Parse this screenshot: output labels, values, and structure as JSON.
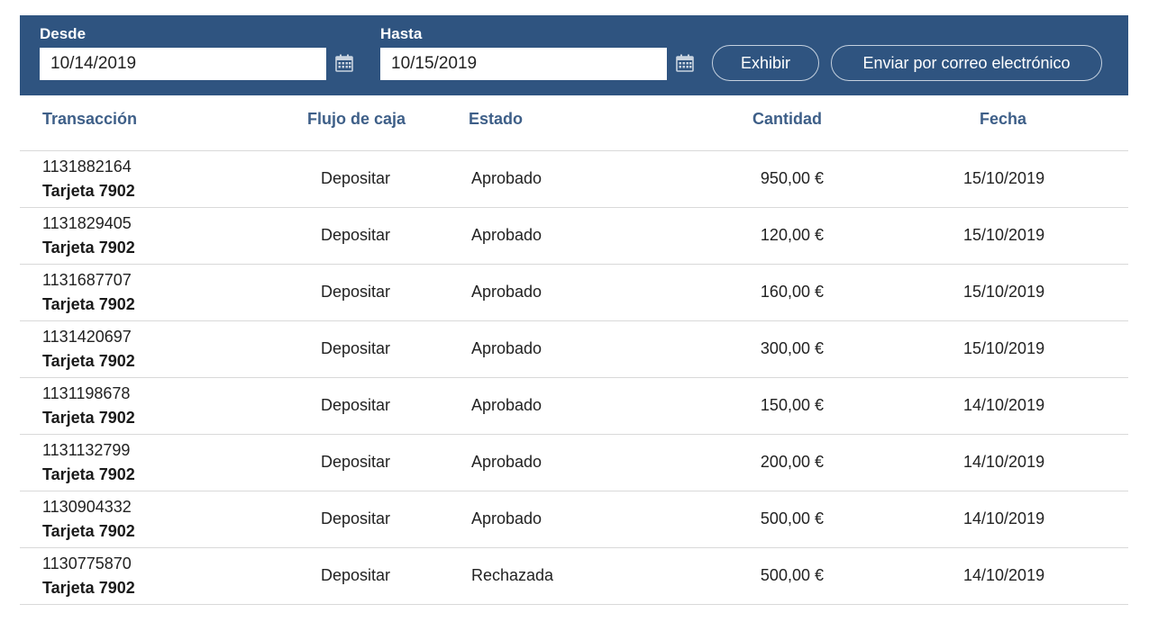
{
  "filters": {
    "from_label": "Desde",
    "from_value": "10/14/2019",
    "to_label": "Hasta",
    "to_value": "10/15/2019",
    "show_button": "Exhibir",
    "email_button": "Enviar por correo electrónico",
    "calendar_icon": "calendar-icon"
  },
  "colors": {
    "header_bg": "#2f5480",
    "column_header_text": "#3e5f88"
  },
  "table": {
    "columns": [
      "Transacción",
      "Flujo de caja",
      "Estado",
      "Cantidad",
      "Fecha"
    ],
    "rows": [
      {
        "id": "1131882164",
        "card": "Tarjeta 7902",
        "flow": "Depositar",
        "status": "Aprobado",
        "amount": "950,00 €",
        "date": "15/10/2019"
      },
      {
        "id": "1131829405",
        "card": "Tarjeta 7902",
        "flow": "Depositar",
        "status": "Aprobado",
        "amount": "120,00 €",
        "date": "15/10/2019"
      },
      {
        "id": "1131687707",
        "card": "Tarjeta 7902",
        "flow": "Depositar",
        "status": "Aprobado",
        "amount": "160,00 €",
        "date": "15/10/2019"
      },
      {
        "id": "1131420697",
        "card": "Tarjeta 7902",
        "flow": "Depositar",
        "status": "Aprobado",
        "amount": "300,00 €",
        "date": "15/10/2019"
      },
      {
        "id": "1131198678",
        "card": "Tarjeta 7902",
        "flow": "Depositar",
        "status": "Aprobado",
        "amount": "150,00 €",
        "date": "14/10/2019"
      },
      {
        "id": "1131132799",
        "card": "Tarjeta 7902",
        "flow": "Depositar",
        "status": "Aprobado",
        "amount": "200,00 €",
        "date": "14/10/2019"
      },
      {
        "id": "1130904332",
        "card": "Tarjeta 7902",
        "flow": "Depositar",
        "status": "Aprobado",
        "amount": "500,00 €",
        "date": "14/10/2019"
      },
      {
        "id": "1130775870",
        "card": "Tarjeta 7902",
        "flow": "Depositar",
        "status": "Rechazada",
        "amount": "500,00 €",
        "date": "14/10/2019"
      }
    ]
  }
}
